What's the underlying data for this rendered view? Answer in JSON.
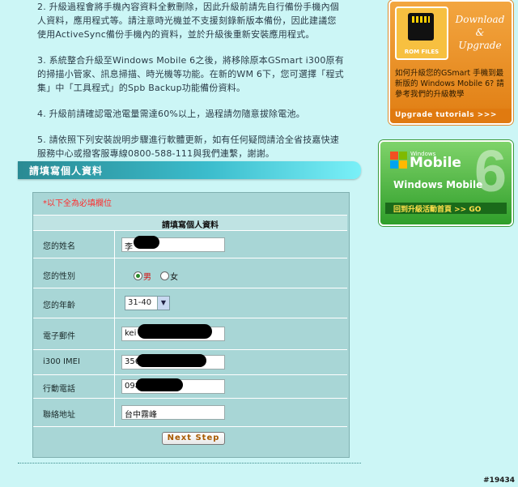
{
  "notes": [
    "2. 升級過程會將手機內容資料全數刪除，因此升級前請先自行備份手機內個人資料，應用程式等。請注意時光機並不支援刻錄新版本備份，因此建議您使用ActiveSync備份手機內的資料，並於升級後重新安裝應用程式。",
    "3. 系統整合升級至Windows Mobile 6之後，將移除原本GSmart i300原有的掃描小管家、訊息掃描、時光機等功能。在新的WM 6下，您可選擇「程式集」中「工具程式」的Spb Backup功能備份資料。",
    "4. 升級前請確認電池電量需達60%以上，過程請勿隨意拔除電池。",
    "5. 請依照下列安裝說明步驟進行軟體更新，如有任何疑問請洽全省技嘉快速服務中心或撥客服專線0800-588-111與我們連繫，謝謝。"
  ],
  "section_title": "請填寫個人資料",
  "form": {
    "required_note": "*以下全為必填欄位",
    "title": "請填寫個人資料",
    "fields": {
      "name": {
        "label": "您的姓名",
        "value": "李"
      },
      "gender": {
        "label": "您的性別",
        "male": "男",
        "female": "女",
        "selected": "男"
      },
      "age": {
        "label": "您的年齡",
        "value": "31-40"
      },
      "email": {
        "label": "電子郵件",
        "value": "kei"
      },
      "imei": {
        "label": "i300 IMEI",
        "value": "356"
      },
      "mobile": {
        "label": "行動電話",
        "value": "098"
      },
      "address": {
        "label": "聯絡地址",
        "value": "台中霧峰"
      }
    },
    "submit_label": "Next Step"
  },
  "ads": {
    "rom": {
      "icon_label": "ROM FILES",
      "heading_line1": "Download",
      "heading_line2": "&",
      "heading_line3": "Upgrade",
      "description": "如何升級您的GSmart 手機到最新版的 Windows Mobile 6? 請參考我們的升級教學",
      "link": "Upgrade tutorials >>>"
    },
    "wm6": {
      "small": "Windows",
      "brand": "Mobile",
      "title": "Windows Mobile",
      "big_number": "6",
      "back_link": "回到升級活動首頁 >> GO"
    }
  },
  "watermark": "#19434"
}
